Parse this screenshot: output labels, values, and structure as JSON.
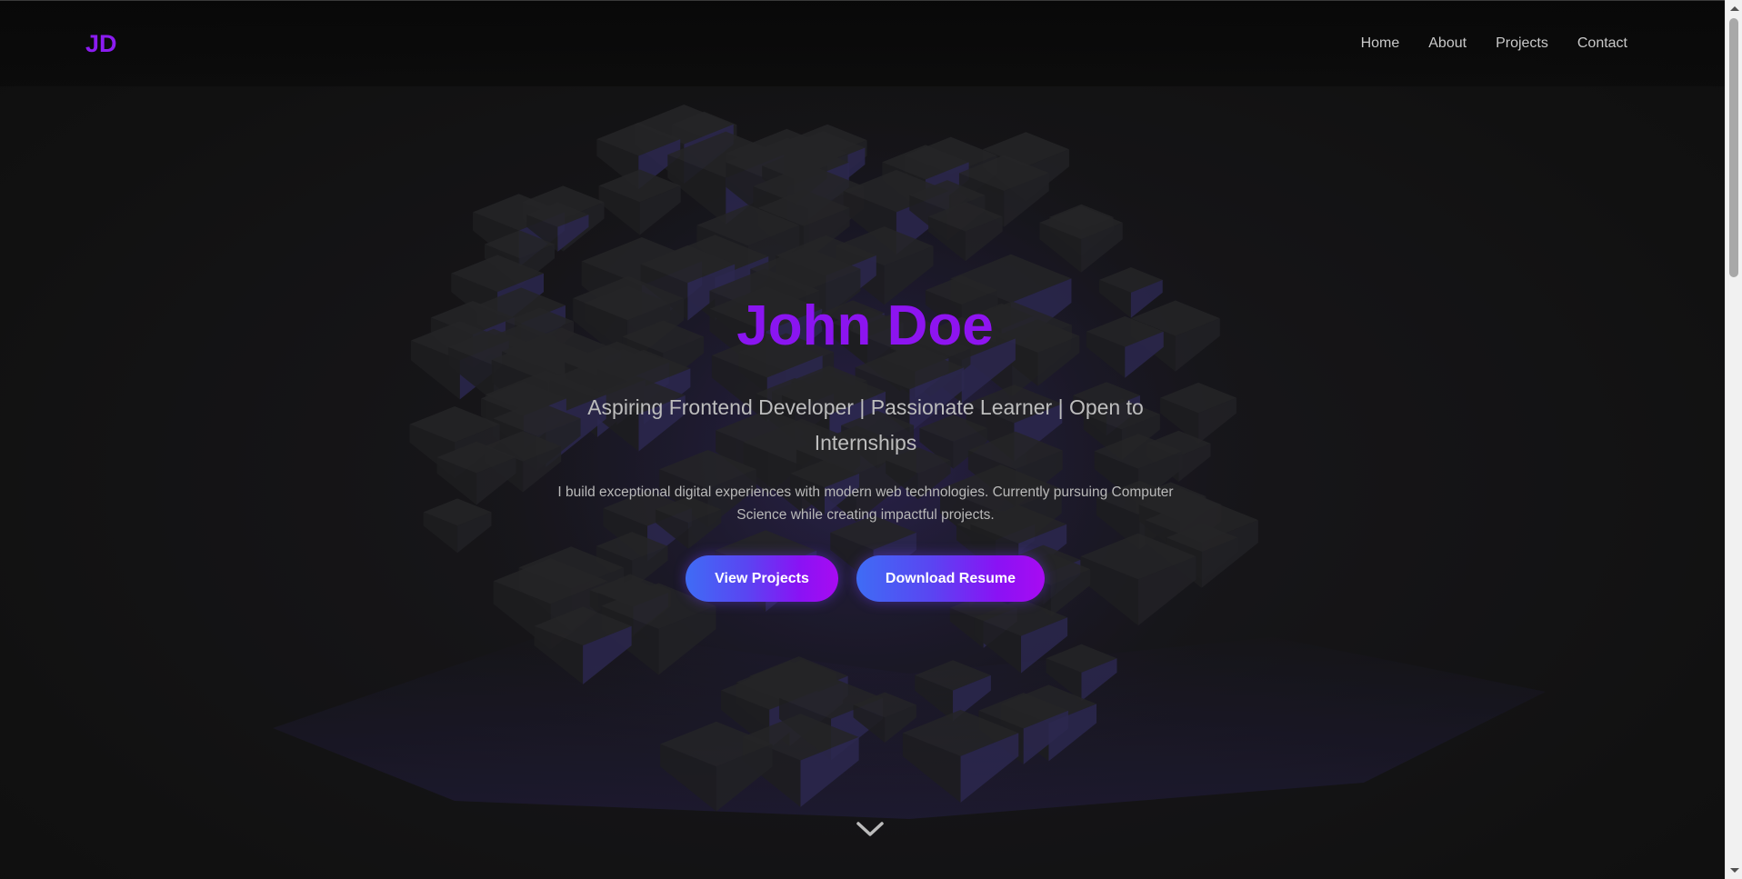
{
  "nav": {
    "logo": "JD",
    "links": [
      "Home",
      "About",
      "Projects",
      "Contact"
    ]
  },
  "hero": {
    "title": "John Doe",
    "subtitle": "Aspiring Frontend Developer | Passionate Learner | Open to Internships",
    "description": "I build exceptional digital experiences with modern web technologies. Currently pursuing Computer Science while creating impactful projects.",
    "buttons": {
      "primary": "View Projects",
      "secondary": "Download Resume"
    },
    "scroll_icon": "chevron-down-icon"
  },
  "colors": {
    "accent": "#8b1cf0",
    "button_gradient_start": "#3f6cf5",
    "button_gradient_end": "#a80bf2",
    "background": "#121212",
    "text_muted": "#bdbdbd"
  }
}
